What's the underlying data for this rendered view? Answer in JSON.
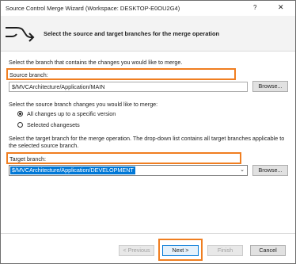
{
  "window": {
    "title": "Source Control Merge Wizard (Workspace: DESKTOP-E0OU2G4)",
    "help": "?",
    "close": "✕"
  },
  "header": {
    "title": "Select the source and target branches for the merge operation"
  },
  "source": {
    "instruction": "Select the branch that contains the changes you would like to merge.",
    "label": "Source branch:",
    "value": "$/MVCArchitecture/Application/MAIN",
    "browse_label": "Browse..."
  },
  "changes": {
    "instruction": "Select the source branch changes you would like to merge:",
    "options": [
      {
        "label": "All changes up to a specific version",
        "checked": true
      },
      {
        "label": "Selected changesets",
        "checked": false
      }
    ]
  },
  "target": {
    "instruction": "Select the target branch for the merge operation.  The drop-down list contains all target branches applicable to the selected source branch.",
    "label": "Target branch:",
    "value": "$/MVCArchitecture/Application/DEVELOPMENT",
    "browse_label": "Browse..."
  },
  "footer": {
    "previous_label": "< Previous",
    "next_label": "Next >",
    "finish_label": "Finish",
    "cancel_label": "Cancel"
  },
  "colors": {
    "highlight": "#f07e20",
    "selection": "#0078d7"
  },
  "icons": {
    "wizard": "merge-arrow-icon",
    "dropdown": "chevron-down-icon"
  }
}
